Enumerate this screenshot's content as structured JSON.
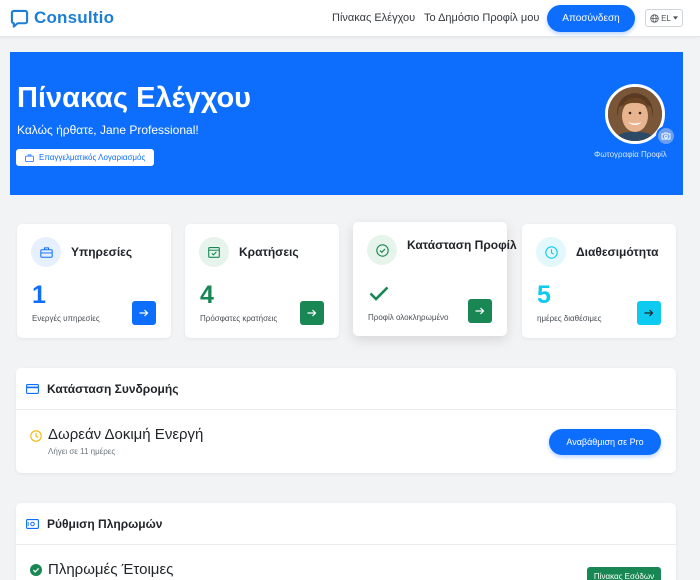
{
  "nav": {
    "brand": "Consultio",
    "dashboard_link": "Πίνακας Ελέγχου",
    "public_profile_link": "Το Δημόσιο Προφίλ μου",
    "logout": "Αποσύνδεση",
    "language": "EL",
    "icons": {
      "brand": "chat-bubble-icon",
      "language": "globe-icon",
      "language_caret": "caret-down-icon"
    }
  },
  "hero": {
    "title": "Πίνακας Ελέγχου",
    "welcome": "Καλώς ήρθατε, Jane Professional!",
    "account_type": "Επαγγελματικός Λογαριασμός",
    "avatar_label": "Φωτογραφία Προφίλ",
    "background": "#0d6efd",
    "icons": {
      "account": "briefcase-icon",
      "avatar_action": "camera-icon"
    }
  },
  "stats": [
    {
      "title": "Υπηρεσίες",
      "value": "1",
      "subtitle": "Ενεργές υπηρεσίες",
      "icon": "briefcase-icon",
      "accent": "#0d6efd",
      "icon_bg": "#e7f0ff",
      "arrow_bg": "#0d6efd"
    },
    {
      "title": "Κρατήσεις",
      "value": "4",
      "subtitle": "Πρόσφατες κρατήσεις",
      "icon": "calendar-check-icon",
      "accent": "#198754",
      "icon_bg": "#e6f4ec",
      "arrow_bg": "#198754"
    },
    {
      "title": "Κατάσταση Προφίλ",
      "value": "",
      "subtitle": "Προφίλ ολοκληρωμένο",
      "icon": "check-circle-icon",
      "accent": "#198754",
      "icon_bg": "#e6f4ec",
      "arrow_bg": "#198754",
      "status_icon": "checkmark-icon"
    },
    {
      "title": "Διαθεσιμότητα",
      "value": "5",
      "subtitle": "ημέρες διαθέσιμες",
      "icon": "clock-icon",
      "accent": "#0dcaf0",
      "icon_bg": "#e3f8fc",
      "arrow_bg": "#0dcaf0"
    }
  ],
  "subscription": {
    "title": "Κατάσταση Συνδρομής",
    "status": "Δωρεάν Δοκιμή Ενεργή",
    "note": "Λήγει σε 11 ημέρες",
    "upgrade": "Αναβάθμιση σε Pro",
    "icons": {
      "header": "credit-card-icon",
      "status": "clock-icon"
    },
    "status_color": "#f2b705"
  },
  "payments": {
    "title": "Ρύθμιση Πληρωμών",
    "status": "Πληρωμές Έτοιμες",
    "revenue": "Πίνακας Εσόδων",
    "icons": {
      "header": "payments-icon",
      "status": "check-circle-icon"
    },
    "status_color": "#198754"
  }
}
